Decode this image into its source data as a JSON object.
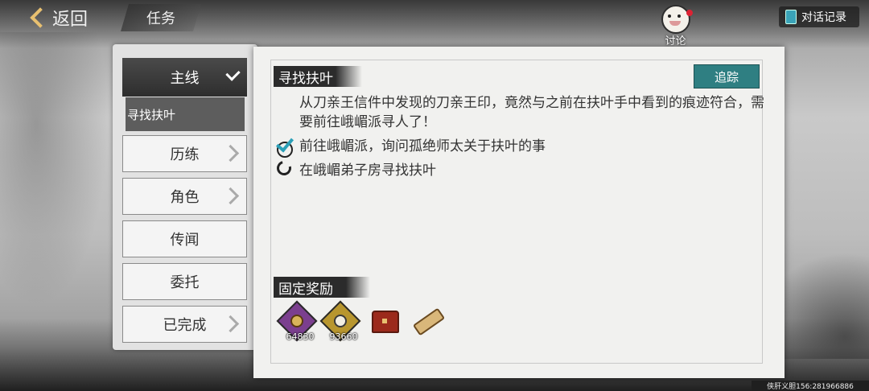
{
  "top_bar": {
    "back_label": "返回",
    "title_tab": "任务",
    "discuss_label": "讨论",
    "history_label": "对话记录"
  },
  "nav": {
    "main_label": "主线",
    "sub_item": "寻找扶叶",
    "items": [
      {
        "label": "历练",
        "has_arrow": true
      },
      {
        "label": "角色",
        "has_arrow": true
      },
      {
        "label": "传闻",
        "has_arrow": false
      },
      {
        "label": "委托",
        "has_arrow": false
      },
      {
        "label": "已完成",
        "has_arrow": true
      }
    ]
  },
  "quest": {
    "title": "寻找扶叶",
    "track_label": "追踪",
    "description": "从刀亲王信件中发现的刀亲王印，竟然与之前在扶叶手中看到的痕迹符合，需要前往峨嵋派寻人了！",
    "tasks": [
      {
        "text": "前往峨嵋派，询问孤绝师太关于扶叶的事",
        "status": "done",
        "icon": "check-icon"
      },
      {
        "text": "在峨嵋弟子房寻找扶叶",
        "status": "in-progress",
        "icon": "loading-ring-icon"
      }
    ]
  },
  "rewards": {
    "title": "固定奖励",
    "items": [
      {
        "name": "coin-icon",
        "count": "64830",
        "color": "#7b3f8f"
      },
      {
        "name": "silver-icon",
        "count": "93660",
        "color": "#b8962e"
      },
      {
        "name": "treasure-chest-icon",
        "count": "",
        "color": "#9c2a1c"
      },
      {
        "name": "scroll-icon",
        "count": "",
        "color": "#d9b77a"
      }
    ]
  },
  "footer": {
    "text": "侠肝义胆156:281966886"
  },
  "colors": {
    "accent": "#2f7f82",
    "check": "#2ba0b8",
    "back_chevron": "#e8c070"
  }
}
